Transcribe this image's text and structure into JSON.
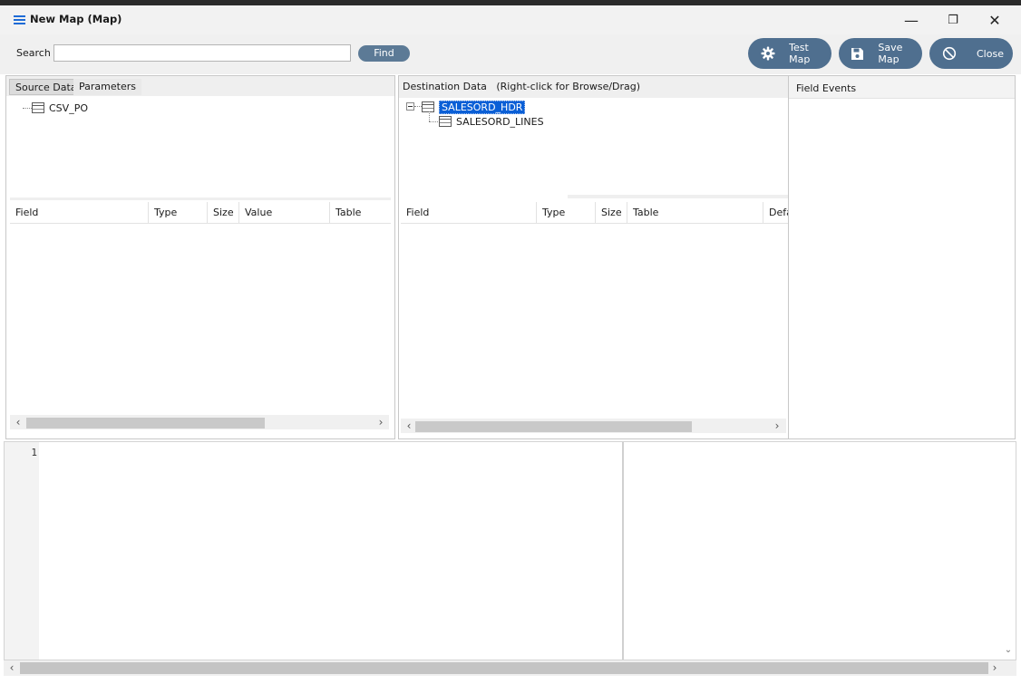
{
  "window": {
    "title": "New Map (Map)",
    "minimize_glyph": "—",
    "restore_glyph": "❐",
    "close_glyph": "✕"
  },
  "toolbar": {
    "search_label": "Search",
    "search_value": "",
    "find_label": "Find",
    "test_map_label": "Test Map",
    "save_map_label": "Save Map",
    "close_label": "Close"
  },
  "source_panel": {
    "tabs": [
      "Source Data",
      "Parameters"
    ],
    "active_tab": "Source Data",
    "tree": [
      {
        "label": "CSV_PO"
      }
    ],
    "columns": [
      "Field",
      "Type",
      "Size",
      "Value",
      "Table"
    ]
  },
  "destination_panel": {
    "header": "Destination Data   (Right-click for Browse/Drag)",
    "tree": [
      {
        "label": "SALESORD_HDR",
        "selected": true,
        "expanded": true
      },
      {
        "label": "SALESORD_LINES",
        "selected": false
      }
    ],
    "columns": [
      "Field",
      "Type",
      "Size",
      "Table",
      "Defa"
    ]
  },
  "events_panel": {
    "header": "Field Events"
  },
  "editor": {
    "line_number": "1"
  },
  "colors": {
    "button_bg": "#4f6f8f",
    "find_bg": "#5c7a96",
    "selection": "#0a5fd6",
    "accent_icon": "#1e6bd6"
  },
  "icons": {
    "app": "hamburger-icon",
    "test_map": "gear-icon",
    "save_map": "floppy-disk-icon",
    "close": "prohibited-icon",
    "tree_node": "table-icon",
    "collapse": "minus-box-icon"
  }
}
